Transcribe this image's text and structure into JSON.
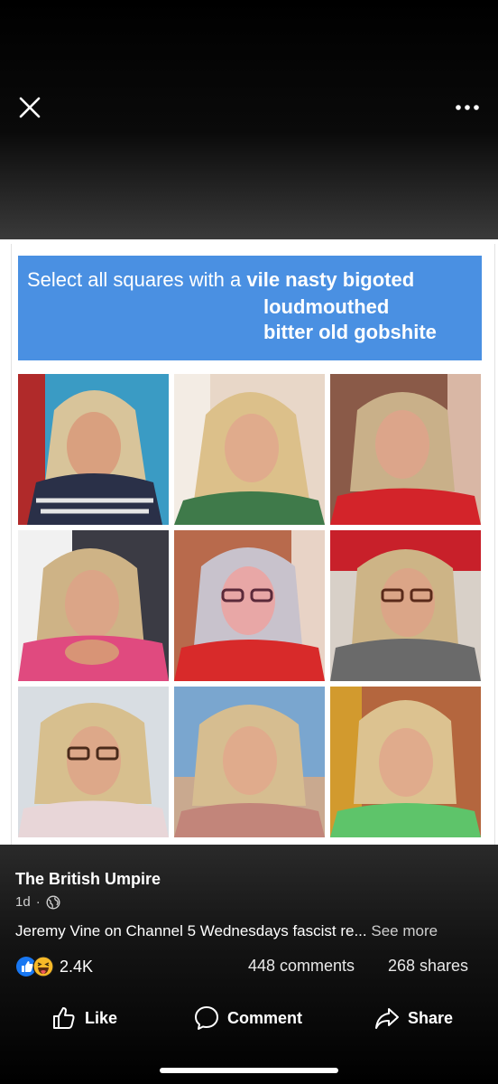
{
  "viewer": {
    "close_icon": "close-icon",
    "more_icon": "more-horizontal-icon"
  },
  "image": {
    "banner_line1": "Select all squares with a",
    "banner_line1_bold": "vile nasty bigoted",
    "banner_line2": "loudmouthed",
    "banner_line3": "bitter old gobshite",
    "banner_color": "#4a90e2"
  },
  "post": {
    "author": "The British Umpire",
    "time": "1d",
    "separator": "·",
    "audience_icon": "globe-icon",
    "caption": "Jeremy Vine on Channel 5 Wednesdays fascist re...",
    "see_more": "See more",
    "reaction_count": "2.4K",
    "comments": "448 comments",
    "shares": "268 shares"
  },
  "actions": {
    "like": "Like",
    "comment": "Comment",
    "share": "Share"
  }
}
